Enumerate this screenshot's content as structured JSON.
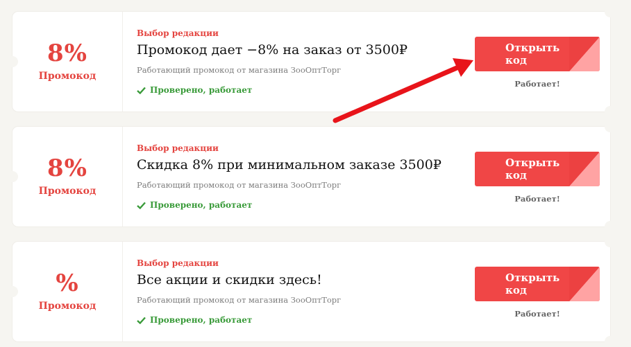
{
  "offers": [
    {
      "percent": "8%",
      "percent_label": "Промокод",
      "badge": "Выбор редакции",
      "title": "Промокод дает −8% на заказ от 3500₽",
      "description": "Работающий промокод от магазина ЗооОптТорг",
      "verified": "Проверено, работает",
      "button": "Открыть код",
      "status": "Работает!"
    },
    {
      "percent": "8%",
      "percent_label": "Промокод",
      "badge": "Выбор редакции",
      "title": "Скидка 8% при минимальном заказе 3500₽",
      "description": "Работающий промокод от магазина ЗооОптТорг",
      "verified": "Проверено, работает",
      "button": "Открыть код",
      "status": "Работает!"
    },
    {
      "percent": "%",
      "percent_label": "Промокод",
      "badge": "Выбор редакции",
      "title": "Все акции и скидки здесь!",
      "description": "Работающий промокод от магазина ЗооОптТорг",
      "verified": "Проверено, работает",
      "button": "Открыть код",
      "status": "Работает!"
    }
  ],
  "icons": {
    "verified": "check-icon",
    "annotation": "red-arrow-icon"
  },
  "colors": {
    "accent": "#e4443f",
    "button": "#f04646",
    "verified": "#3a9b3a",
    "arrow": "#e8141a"
  }
}
